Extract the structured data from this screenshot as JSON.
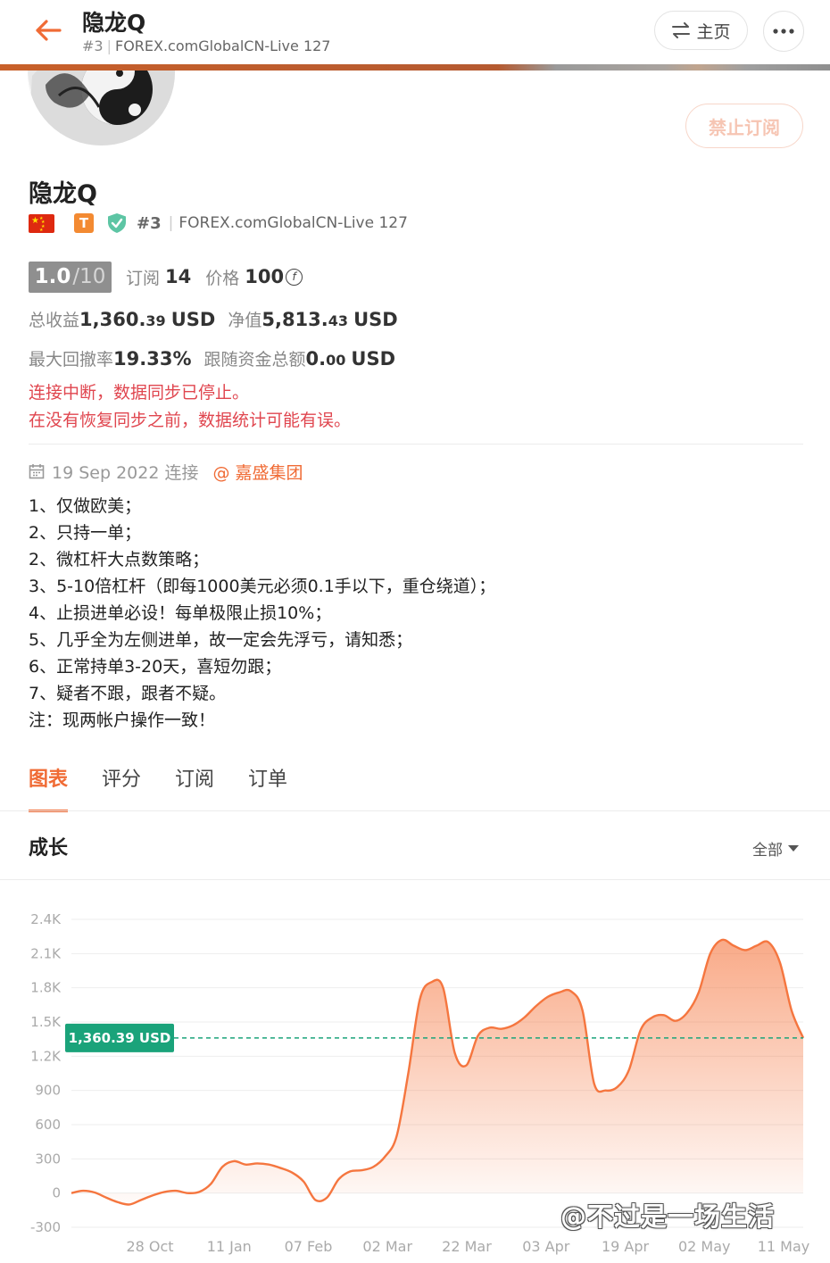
{
  "topbar": {
    "title": "隐龙Q",
    "rank": "#3",
    "server": "FOREX.comGlobalCN-Live 127",
    "home_label": "主页"
  },
  "profile": {
    "name": "隐龙Q",
    "rank": "#3",
    "server": "FOREX.comGlobalCN-Live 127",
    "badge_letter": "T",
    "unsubscribe_label": "禁止订阅"
  },
  "stats": {
    "score": "1.0",
    "score_max": "/10",
    "subs_label": "订阅",
    "subs_value": "14",
    "price_label": "价格",
    "price_value": "100",
    "price_currency_symbol": "f",
    "total_profit_label": "总收益",
    "total_profit_int": "1,360.",
    "total_profit_dec": "39",
    "total_profit_unit": "USD",
    "equity_label": "净值",
    "equity_int": "5,813.",
    "equity_dec": "43",
    "equity_unit": "USD",
    "drawdown_label": "最大回撤率",
    "drawdown_value": "19.33%",
    "follow_label": "跟随资金总额",
    "follow_int": "0.",
    "follow_dec": "00",
    "follow_unit": "USD"
  },
  "warning": {
    "line1": "连接中断，数据同步已停止。",
    "line2": "在没有恢复同步之前，数据统计可能有误。"
  },
  "meta": {
    "date": "19 Sep 2022 连接",
    "broker": "@ 嘉盛集团"
  },
  "description": [
    "1、仅做欧美；",
    "2、只持一单；",
    "2、微杠杆大点数策略；",
    "3、5-10倍杠杆（即每1000美元必须0.1手以下，重仓绕道）；",
    "4、止损进单必设！每单极限止损10%；",
    "5、几乎全为左侧进单，故一定会先浮亏，请知悉；",
    "6、正常持单3-20天，喜短勿跟；",
    "7、疑者不跟，跟者不疑。",
    "注：现两帐户操作一致！"
  ],
  "tabs": [
    {
      "label": "图表",
      "active": true
    },
    {
      "label": "评分",
      "active": false
    },
    {
      "label": "订阅",
      "active": false
    },
    {
      "label": "订单",
      "active": false
    }
  ],
  "section": {
    "title": "成长",
    "filter_label": "全部"
  },
  "chart_data": {
    "type": "area",
    "title": "成长",
    "y_tick_labels": [
      "2.4K",
      "2.1K",
      "1.8K",
      "1.5K",
      "1.2K",
      "900",
      "600",
      "300",
      "0",
      "-300"
    ],
    "y_ticks": [
      2400,
      2100,
      1800,
      1500,
      1200,
      900,
      600,
      300,
      0,
      -300
    ],
    "ylim": [
      -300,
      2400
    ],
    "x_tick_labels": [
      "28 Oct",
      "11 Jan",
      "07 Feb",
      "02 Mar",
      "22 Mar",
      "03 Apr",
      "19 Apr",
      "02 May",
      "11 May"
    ],
    "current_value": 1360.39,
    "current_label": "1,360.39 USD",
    "color": "#f5763f",
    "reference_color": "#1aa37a",
    "series": [
      {
        "values": [
          0,
          20,
          5,
          -40,
          -80,
          -100,
          -60,
          -20,
          10,
          20,
          0,
          10,
          80,
          230,
          280,
          250,
          260,
          250,
          220,
          180,
          100,
          -60,
          -40,
          120,
          190,
          200,
          230,
          320,
          500,
          1050,
          1700,
          1850,
          1800,
          1230,
          1120,
          1380,
          1450,
          1440,
          1470,
          1540,
          1640,
          1720,
          1760,
          1770,
          1600,
          960,
          900,
          930,
          1080,
          1430,
          1540,
          1560,
          1510,
          1580,
          1760,
          2100,
          2220,
          2170,
          2130,
          2170,
          2200,
          2020,
          1600,
          1360
        ]
      }
    ]
  },
  "watermark": "@不过是一场生活"
}
